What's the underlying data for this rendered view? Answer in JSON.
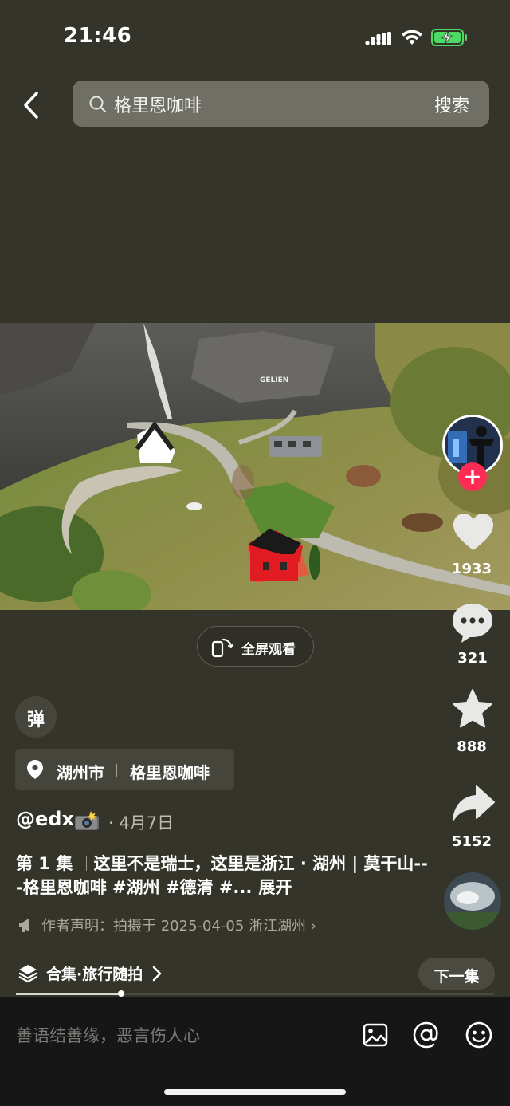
{
  "status_bar": {
    "time": "21:46"
  },
  "search": {
    "query": "格里恩咖啡",
    "button": "搜索"
  },
  "video": {
    "sign_text": "GELIEN"
  },
  "fullscreen": {
    "label": "全屏观看"
  },
  "actions": {
    "likes": "1933",
    "comments": "321",
    "favorites": "888",
    "shares": "5152",
    "follow_symbol": "+"
  },
  "danmu": {
    "label": "弹"
  },
  "location": {
    "city": "湖州市",
    "place": "格里恩咖啡"
  },
  "post": {
    "author": "@edx",
    "date": "· 4月7日",
    "episode": "第 1 集",
    "text": "这里不是瑞士，这里是浙江 · 湖州 | 莫干山---格里恩咖啡 #湖州 #德清 #...",
    "expand": "展开",
    "statement": "作者声明：拍摄于 2025-04-05 浙江湖州 ›"
  },
  "collection": {
    "label": "合集·旅行随拍",
    "next": "下一集",
    "progress": 0.22
  },
  "comment_bar": {
    "placeholder": "善语结善缘，恶言伤人心"
  },
  "colors": {
    "background": "#34342a",
    "accent": "#fe2c55",
    "comment_bar": "#161616"
  }
}
